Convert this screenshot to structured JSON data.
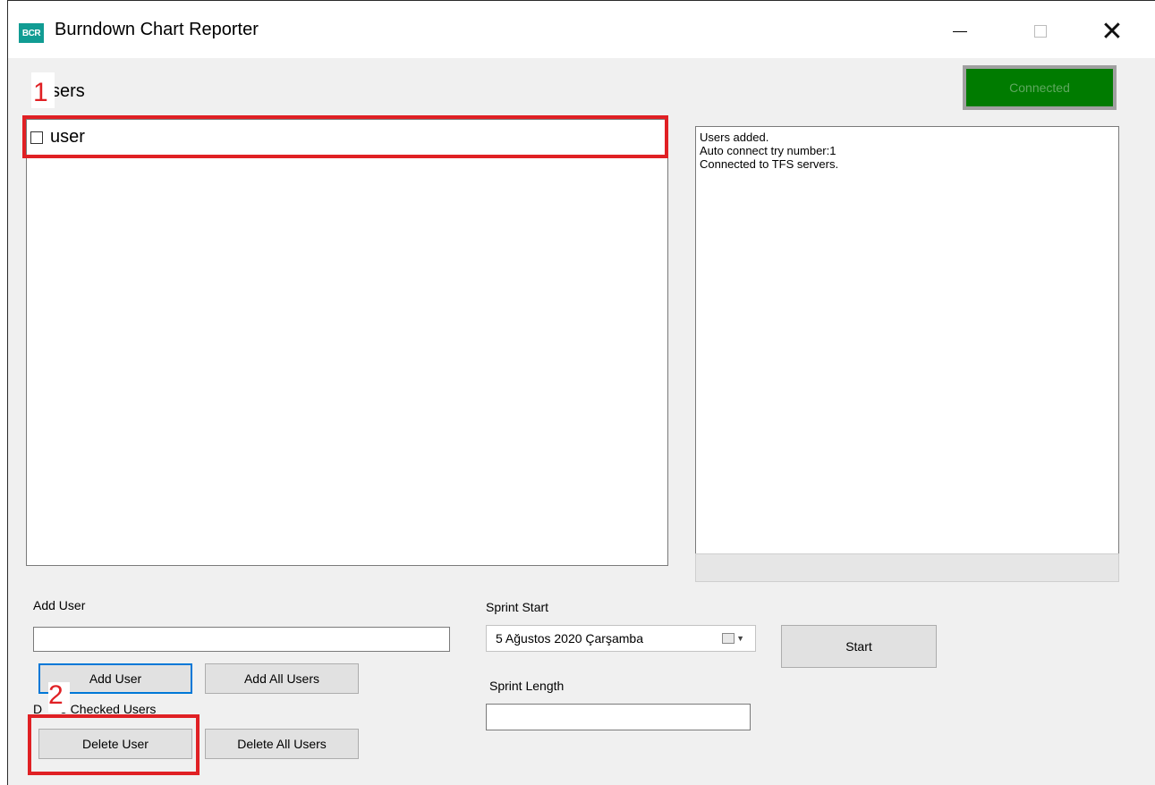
{
  "window": {
    "icon_text": "BCR",
    "title": "Burndown Chart Reporter",
    "close_glyph": "✕"
  },
  "users": {
    "label": "sers",
    "items": [
      {
        "label": "user",
        "checked": false
      }
    ]
  },
  "log": {
    "lines": [
      "Users added.",
      "Auto connect try number:1",
      "Connected to TFS servers."
    ]
  },
  "status": {
    "connected_label": "Connected",
    "color": "#007b00"
  },
  "form": {
    "add_user_label": "Add User",
    "add_user_value": "",
    "add_user_button": "Add User",
    "add_all_users_button": "Add All Users",
    "delete_checked_label": "e Checked Users",
    "delete_checked_prefix": "D",
    "delete_user_button": "Delete User",
    "delete_all_users_button": "Delete All Users",
    "sprint_start_label": "Sprint Start",
    "sprint_start_value": "5 Ağustos 2020 Çarşamba",
    "sprint_length_label": "Sprint Length",
    "sprint_length_value": "",
    "start_button": "Start"
  },
  "annotations": {
    "marker_1": "1",
    "marker_2": "2",
    "color": "#e02024"
  }
}
